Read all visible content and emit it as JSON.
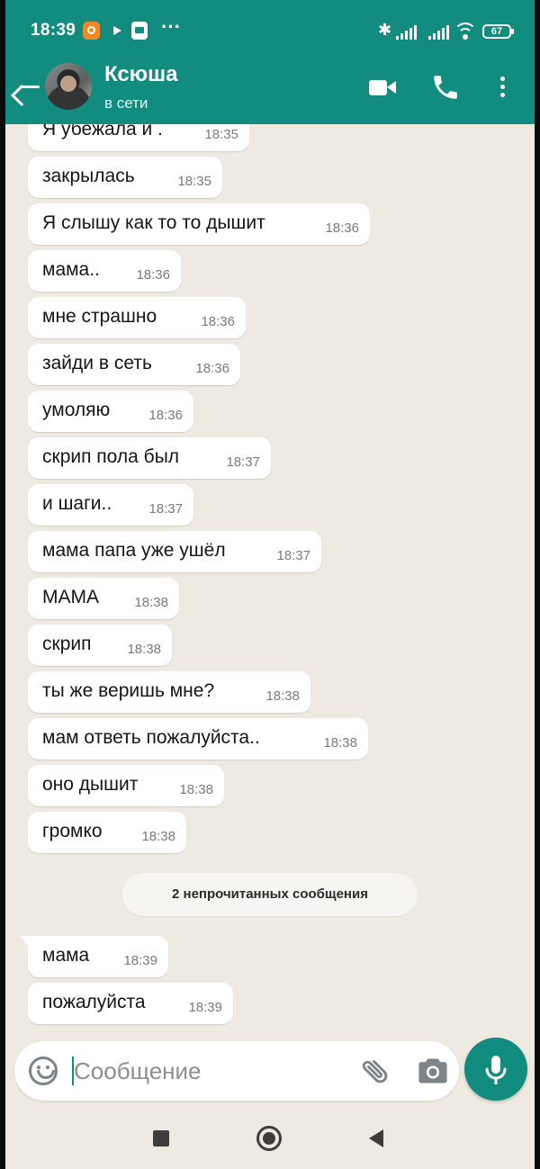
{
  "status_bar": {
    "time": "18:39",
    "battery": "67",
    "icons": [
      "app-notification-icon",
      "play-icon",
      "app-notification-icon",
      "more-notifications-icon",
      "bluetooth-icon",
      "signal-icon",
      "signal-icon",
      "wifi-icon",
      "battery-icon"
    ]
  },
  "header": {
    "contact_name": "Ксюша",
    "contact_status": "в сети",
    "icons": [
      "back-arrow-icon",
      "video-call-icon",
      "phone-icon",
      "more-vert-icon"
    ]
  },
  "messages": [
    {
      "text": "Я убежала и .",
      "time": "18:35"
    },
    {
      "text": "закрылась",
      "time": "18:35"
    },
    {
      "text": "Я слышу как то то дышит",
      "time": "18:36"
    },
    {
      "text": "мама..",
      "time": "18:36"
    },
    {
      "text": "мне страшно",
      "time": "18:36"
    },
    {
      "text": "зайди в сеть",
      "time": "18:36"
    },
    {
      "text": "умоляю",
      "time": "18:36"
    },
    {
      "text": "скрип пола был",
      "time": "18:37"
    },
    {
      "text": "и шаги..",
      "time": "18:37"
    },
    {
      "text": "мама папа уже ушёл",
      "time": "18:37"
    },
    {
      "text": "МАМА",
      "time": "18:38"
    },
    {
      "text": "скрип",
      "time": "18:38"
    },
    {
      "text": "ты же веришь мне?",
      "time": "18:38"
    },
    {
      "text": "мам ответь пожалуйста..",
      "time": "18:38"
    },
    {
      "text": "оно дышит",
      "time": "18:38"
    },
    {
      "text": "громко",
      "time": "18:38"
    }
  ],
  "unread_banner": "2 непрочитанных сообщения",
  "unread_messages": [
    {
      "text": "мама",
      "time": "18:39"
    },
    {
      "text": "пожалуйста",
      "time": "18:39"
    }
  ],
  "composer": {
    "placeholder": "Сообщение",
    "value": "",
    "icons": [
      "emoji-icon",
      "attach-icon",
      "camera-icon",
      "mic-icon"
    ]
  },
  "colors": {
    "header": "#128c7e",
    "chat_background": "#eeeae2",
    "bubble": "#ffffff",
    "mic_button": "#128c7e"
  }
}
